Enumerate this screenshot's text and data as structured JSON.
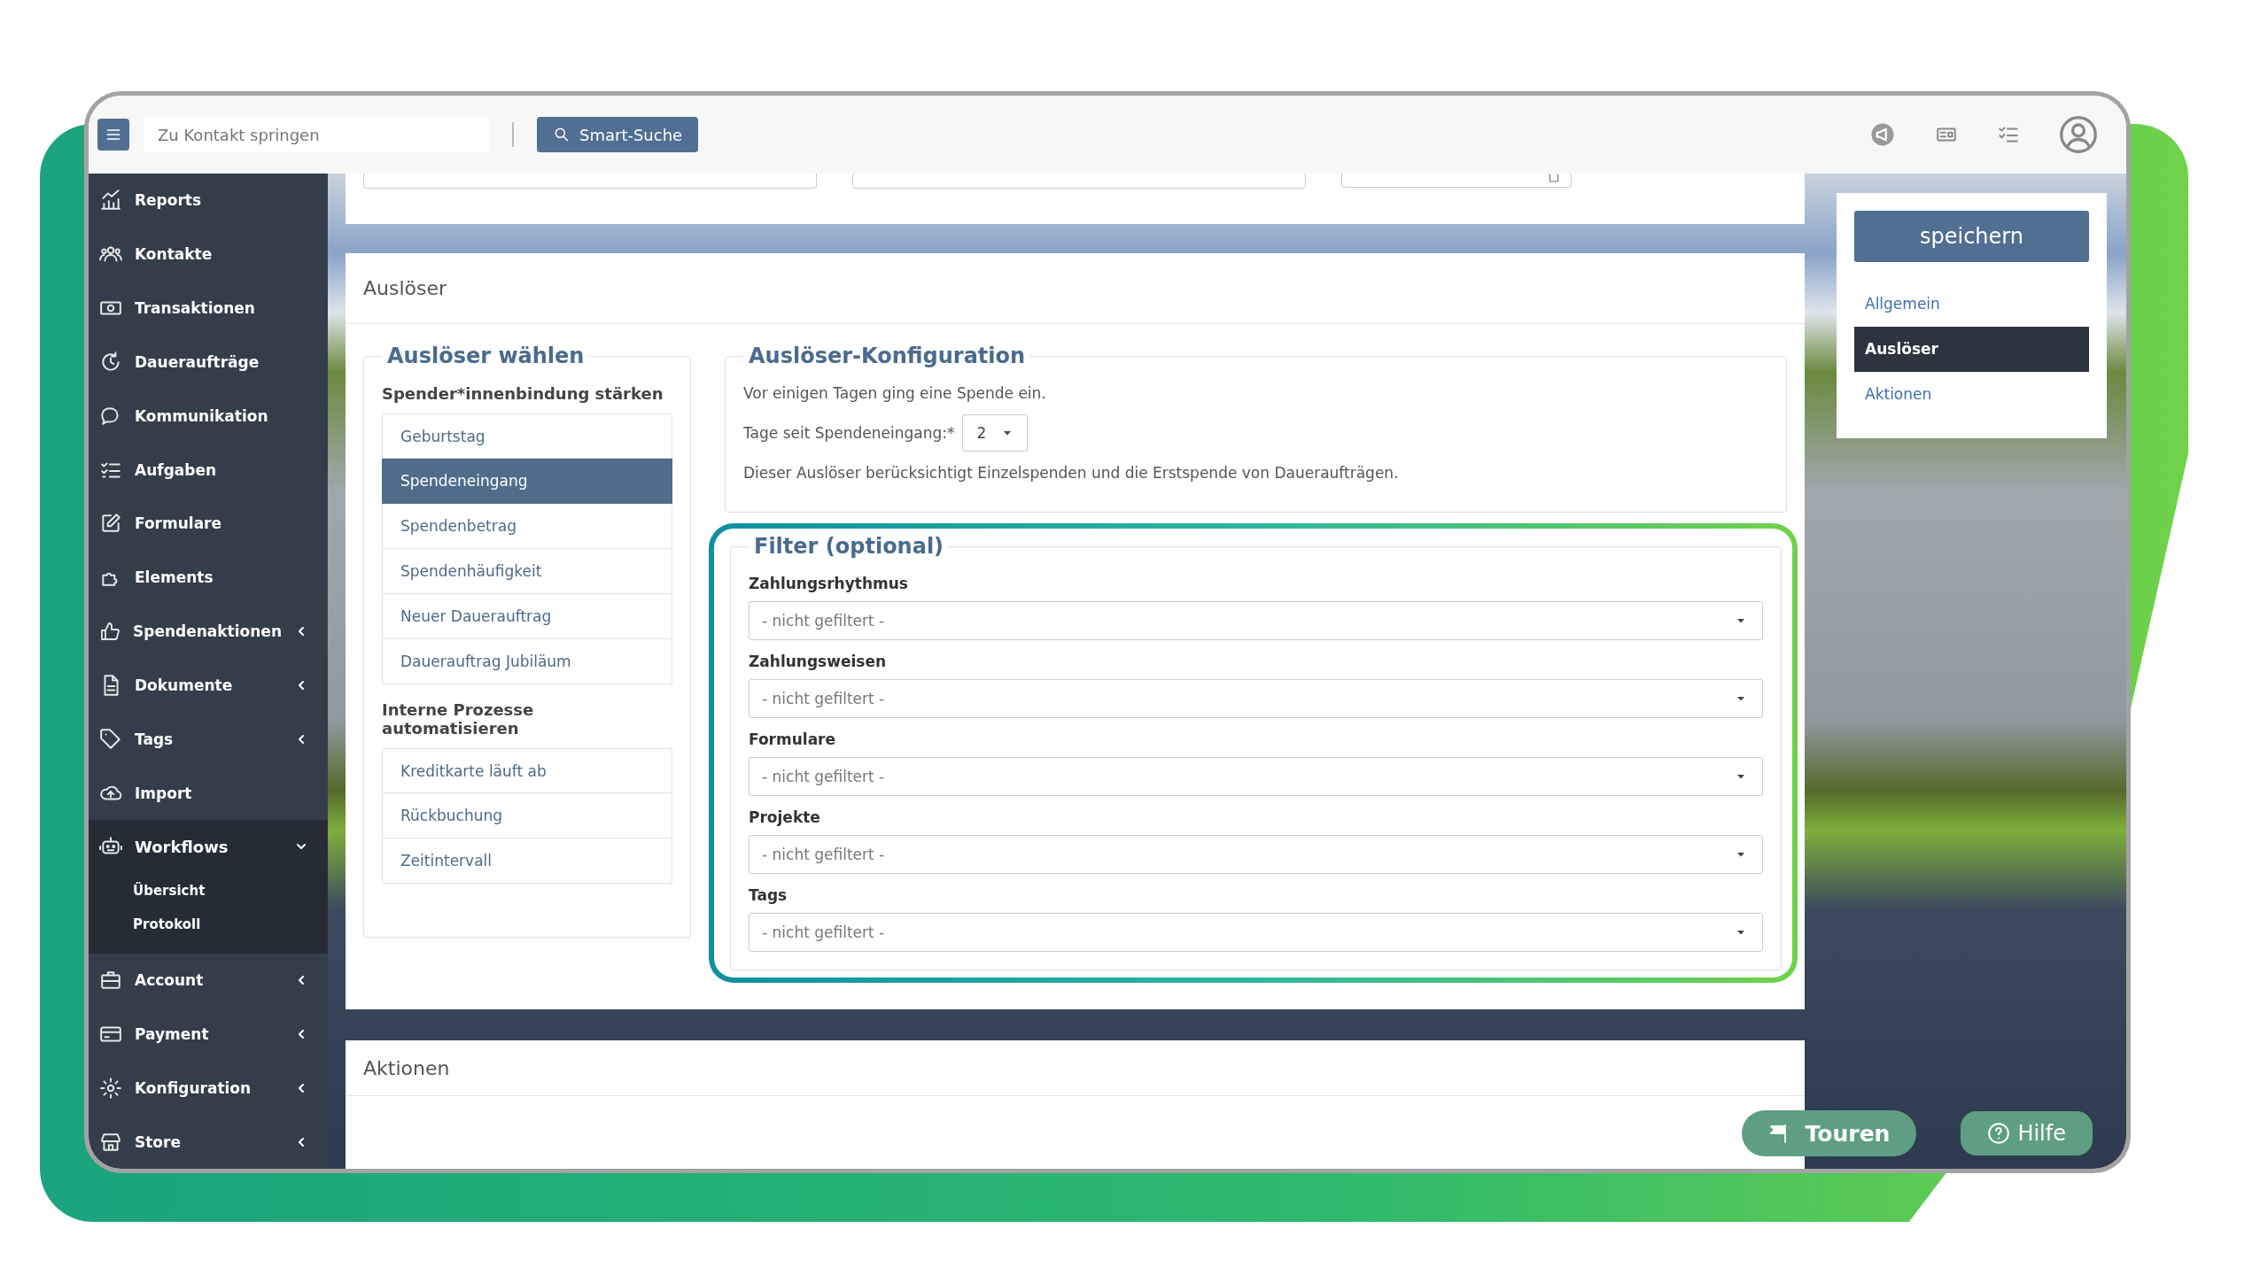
{
  "topbar": {
    "search_placeholder": "Zu Kontakt springen",
    "smart_search": "Smart-Suche"
  },
  "sidebar": {
    "items": [
      {
        "label": "Reports",
        "selected": false
      },
      {
        "label": "Kontakte",
        "selected": false
      },
      {
        "label": "Transaktionen",
        "selected": false
      },
      {
        "label": "Daueraufträge",
        "selected": false
      },
      {
        "label": "Kommunikation",
        "selected": false
      },
      {
        "label": "Aufgaben",
        "selected": false
      },
      {
        "label": "Formulare",
        "selected": false
      },
      {
        "label": "Elements",
        "selected": false
      },
      {
        "label": "Spendenaktionen",
        "selected": false,
        "expanded": false
      },
      {
        "label": "Dokumente",
        "selected": false,
        "expanded": false
      },
      {
        "label": "Tags",
        "selected": false,
        "expanded": false
      },
      {
        "label": "Import",
        "selected": false
      },
      {
        "label": "Workflows",
        "selected": true,
        "expanded": true,
        "children": [
          {
            "label": "Übersicht"
          },
          {
            "label": "Protokoll"
          }
        ]
      },
      {
        "label": "Account",
        "selected": false,
        "expanded": false
      },
      {
        "label": "Payment",
        "selected": false,
        "expanded": false
      },
      {
        "label": "Konfiguration",
        "selected": false,
        "expanded": false
      },
      {
        "label": "Store",
        "selected": false,
        "expanded": false
      }
    ]
  },
  "trigger_section": {
    "title": "Auslöser",
    "chooser": {
      "legend": "Auslöser wählen",
      "groups": [
        {
          "heading": "Spender*innenbindung stärken",
          "items": [
            {
              "label": "Geburtstag",
              "selected": false
            },
            {
              "label": "Spendeneingang",
              "selected": true
            },
            {
              "label": "Spendenbetrag",
              "selected": false
            },
            {
              "label": "Spendenhäufigkeit",
              "selected": false
            },
            {
              "label": "Neuer Dauerauftrag",
              "selected": false
            },
            {
              "label": "Dauerauftrag Jubiläum",
              "selected": false
            }
          ]
        },
        {
          "heading": "Interne Prozesse automatisieren",
          "items": [
            {
              "label": "Kreditkarte läuft ab",
              "selected": false
            },
            {
              "label": "Rückbuchung",
              "selected": false
            },
            {
              "label": "Zeitintervall",
              "selected": false
            }
          ]
        }
      ]
    },
    "config": {
      "legend": "Auslöser-Konfiguration",
      "description": "Vor einigen Tagen ging eine Spende ein.",
      "field_label": "Tage seit Spendeneingang:*",
      "field_value": "2",
      "note": "Dieser Auslöser berücksichtigt Einzelspenden und die Erstspende von Daueraufträgen."
    },
    "filter": {
      "legend": "Filter (optional)",
      "highlighted": true,
      "fields": [
        {
          "label": "Zahlungsrhythmus",
          "placeholder": "- nicht gefiltert -"
        },
        {
          "label": "Zahlungsweisen",
          "placeholder": "- nicht gefiltert -"
        },
        {
          "label": "Formulare",
          "placeholder": "- nicht gefiltert -"
        },
        {
          "label": "Projekte",
          "placeholder": "- nicht gefiltert -"
        },
        {
          "label": "Tags",
          "placeholder": "- nicht gefiltert -"
        }
      ]
    }
  },
  "actions_section": {
    "title": "Aktionen"
  },
  "side_panel": {
    "save": "speichern",
    "nav": [
      {
        "label": "Allgemein",
        "selected": false
      },
      {
        "label": "Auslöser",
        "selected": true
      },
      {
        "label": "Aktionen",
        "selected": false
      }
    ]
  },
  "floating": {
    "tours": "Touren",
    "help": "Hilfe"
  }
}
